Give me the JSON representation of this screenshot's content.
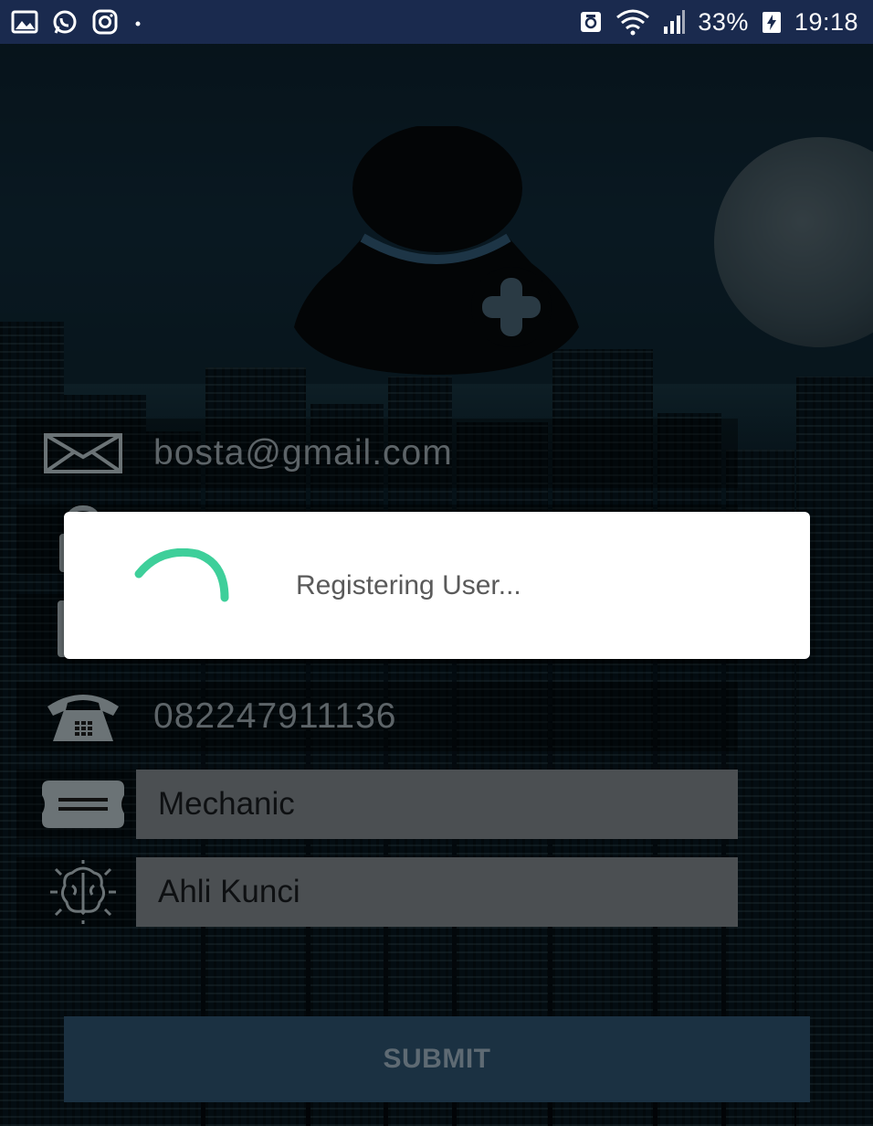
{
  "status_bar": {
    "left_icons": [
      "gallery-icon",
      "whatsapp-icon",
      "instagram-icon",
      "dot-icon"
    ],
    "right_icons": [
      "data-saver-icon",
      "wifi-icon",
      "signal-icon"
    ],
    "battery": "33%",
    "time": "19:18"
  },
  "avatar": {
    "icon": "add-user-icon"
  },
  "form": {
    "email": {
      "icon": "envelope-icon",
      "value": "bosta@gmail.com"
    },
    "password": {
      "icon": "padlock-icon"
    },
    "name": {
      "icon": "user-card-icon"
    },
    "phone": {
      "icon": "telephone-icon",
      "value": "082247911136"
    },
    "profession": {
      "icon": "id-card-icon",
      "value": "Mechanic"
    },
    "skill": {
      "icon": "brain-icon",
      "value": "Ahli Kunci"
    }
  },
  "submit_label": "SUBMIT",
  "dialog": {
    "message": "Registering User..."
  },
  "colors": {
    "spinner": "#3ecf9a",
    "status_bar": "#1a2a4e",
    "dialog_bg": "#ffffff"
  }
}
